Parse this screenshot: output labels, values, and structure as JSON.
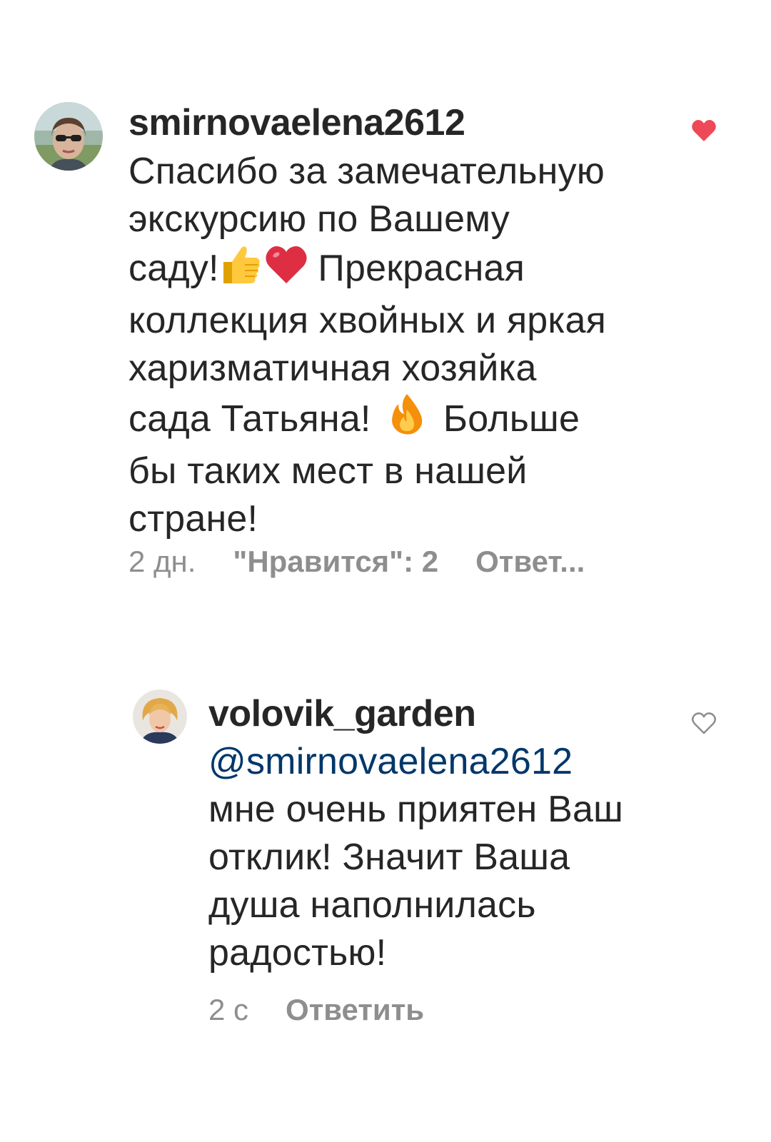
{
  "comments": [
    {
      "username": "smirnovaelena2612",
      "lines": [
        "Спасибо за замечательную",
        "экскурсию по Вашему",
        "саду!",
        "Прекрасная",
        "коллекция хвойных и яркая",
        "харизматичная хозяйка",
        "сада Татьяна!",
        "Больше",
        "бы таких мест в нашей",
        "стране!"
      ],
      "time": "2 дн.",
      "likes": "\"Нравится\": 2",
      "reply": "Ответ...",
      "liked": true,
      "like_icon": "heart-filled-icon",
      "emojis": [
        "thumbs-up-icon",
        "red-heart-icon",
        "fire-icon"
      ]
    },
    {
      "username": "volovik_garden",
      "mention": "@smirnovaelena2612",
      "lines": [
        "мне очень приятен Ваш",
        "отклик! Значит Ваша",
        "душа наполнилась",
        "радостью!"
      ],
      "time": "2 с",
      "reply": "Ответить",
      "liked": false,
      "like_icon": "heart-outline-icon"
    }
  ],
  "colors": {
    "text": "#262626",
    "meta": "#8e8e8e",
    "mention": "#00376b",
    "heart_liked": "#ed4956",
    "heart_outline": "#8e8e8e",
    "background": "#ffffff"
  }
}
